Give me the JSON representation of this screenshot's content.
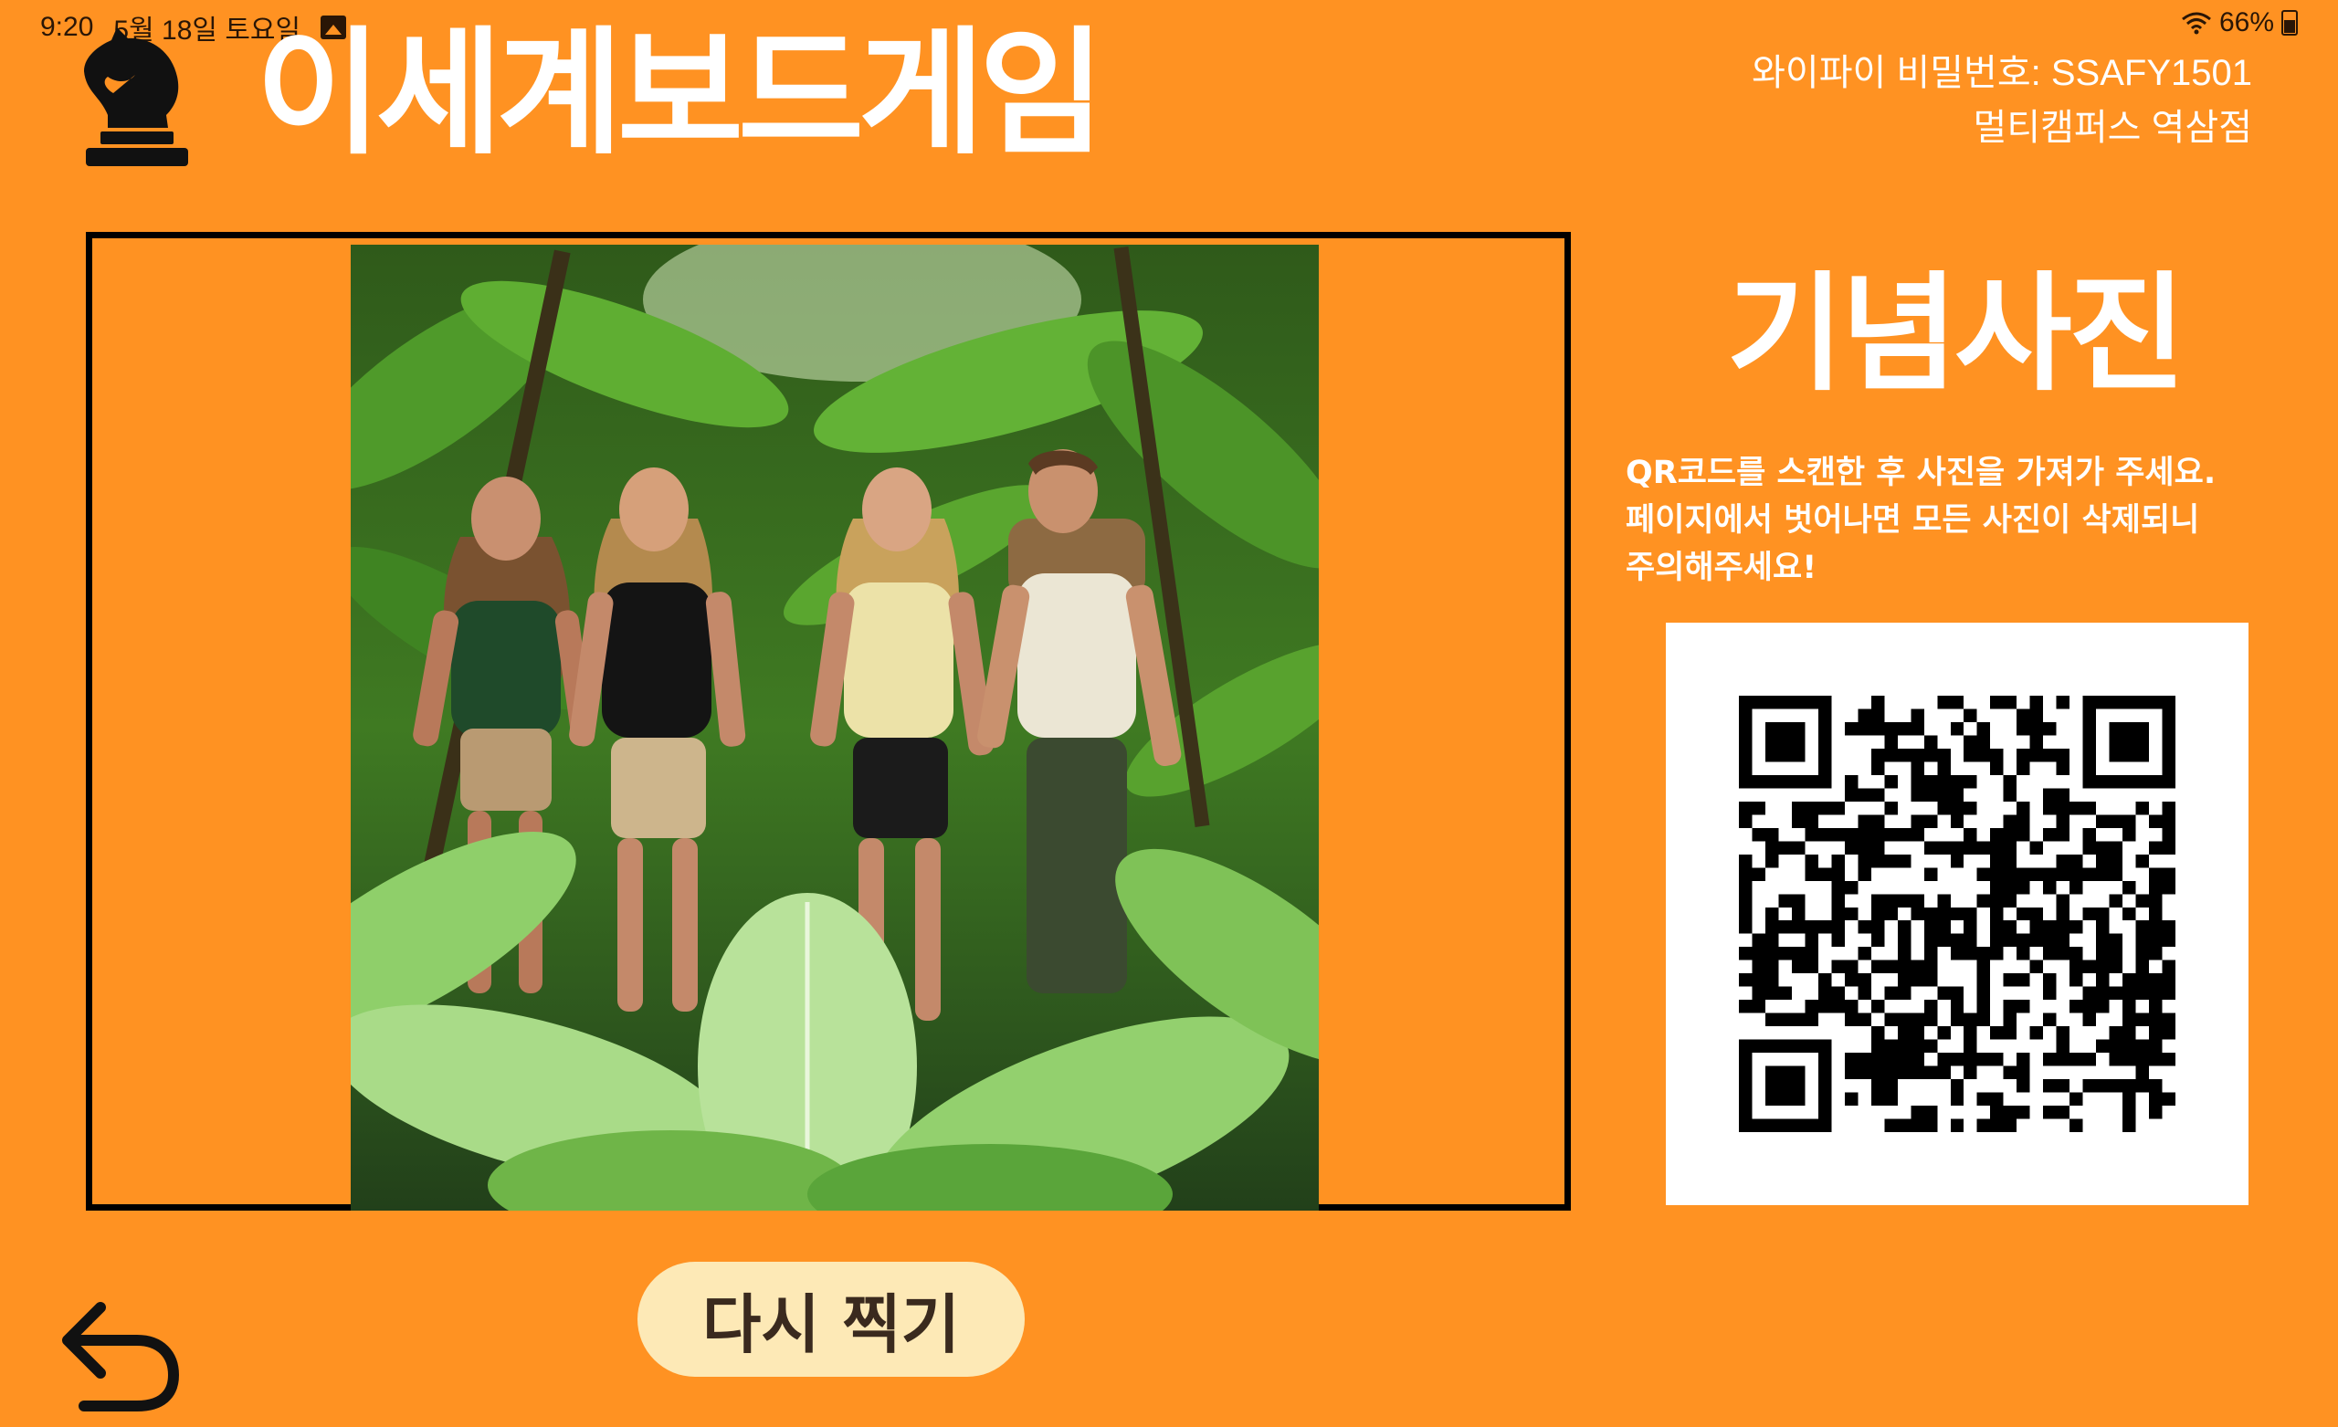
{
  "status_bar": {
    "time": "9:20",
    "date": "5월 18일 토요일",
    "battery": "66%",
    "icons": [
      "gallery-icon",
      "wifi-icon",
      "battery-icon"
    ]
  },
  "header": {
    "title": "이세계보드게임",
    "logo_icon": "chess-knight-icon",
    "wifi_password": "와이파이 비밀번호: SSAFY1501",
    "location": "멀티캠퍼스 역삼점"
  },
  "side": {
    "title": "기념사진",
    "instructions_line1": "QR코드를 스캔한 후 사진을 가져가 주세요.",
    "instructions_line2": "페이지에서 벗어나면 모든 사진이 삭제되니",
    "instructions_line3": "주의해주세요!"
  },
  "actions": {
    "retake": "다시 찍기",
    "back_icon": "back-arrow-icon"
  },
  "colors": {
    "background": "#FF9222",
    "button_bg": "#FDE9B6",
    "text": "#FFFFFF"
  }
}
